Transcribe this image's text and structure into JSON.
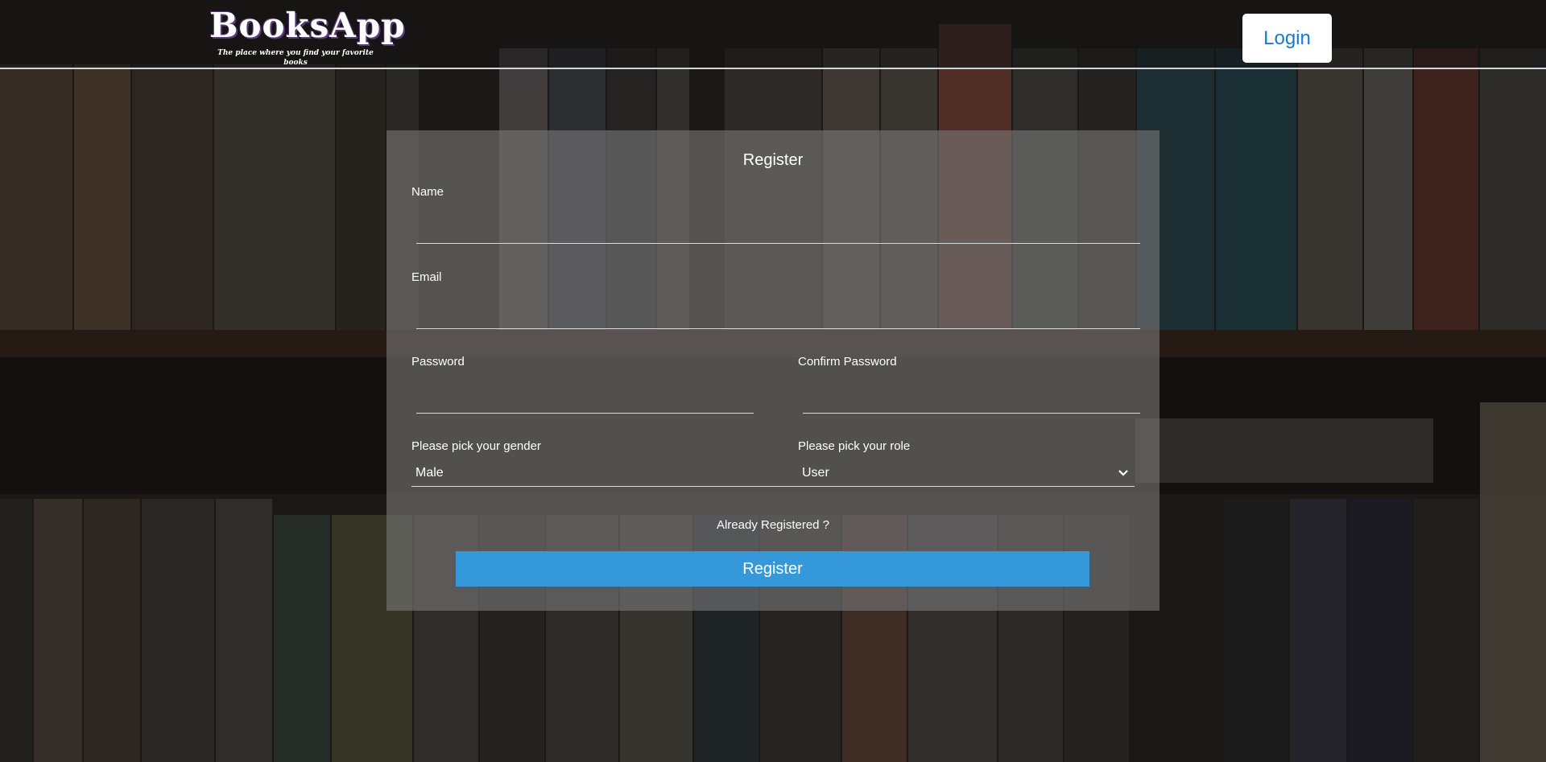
{
  "header": {
    "brand_title": "BooksApp",
    "brand_tagline": "The place where you find your favorite books",
    "login_label": "Login"
  },
  "form": {
    "title": "Register",
    "name_label": "Name",
    "name_value": "",
    "email_label": "Email",
    "email_value": "",
    "password_label": "Password",
    "password_value": "",
    "confirm_password_label": "Confirm Password",
    "confirm_password_value": "",
    "gender_label": "Please pick your gender",
    "gender_selected": "Male",
    "role_label": "Please pick your role",
    "role_selected": "User",
    "already_registered": "Already Registered ?",
    "register_button": "Register"
  },
  "colors": {
    "accent": "#3498db",
    "login_text": "#1a78d6",
    "card_bg": "rgba(120,120,120,0.62)"
  },
  "icons": {
    "gender_chevron": "chevron-down-icon",
    "role_chevron": "chevron-down-icon"
  }
}
